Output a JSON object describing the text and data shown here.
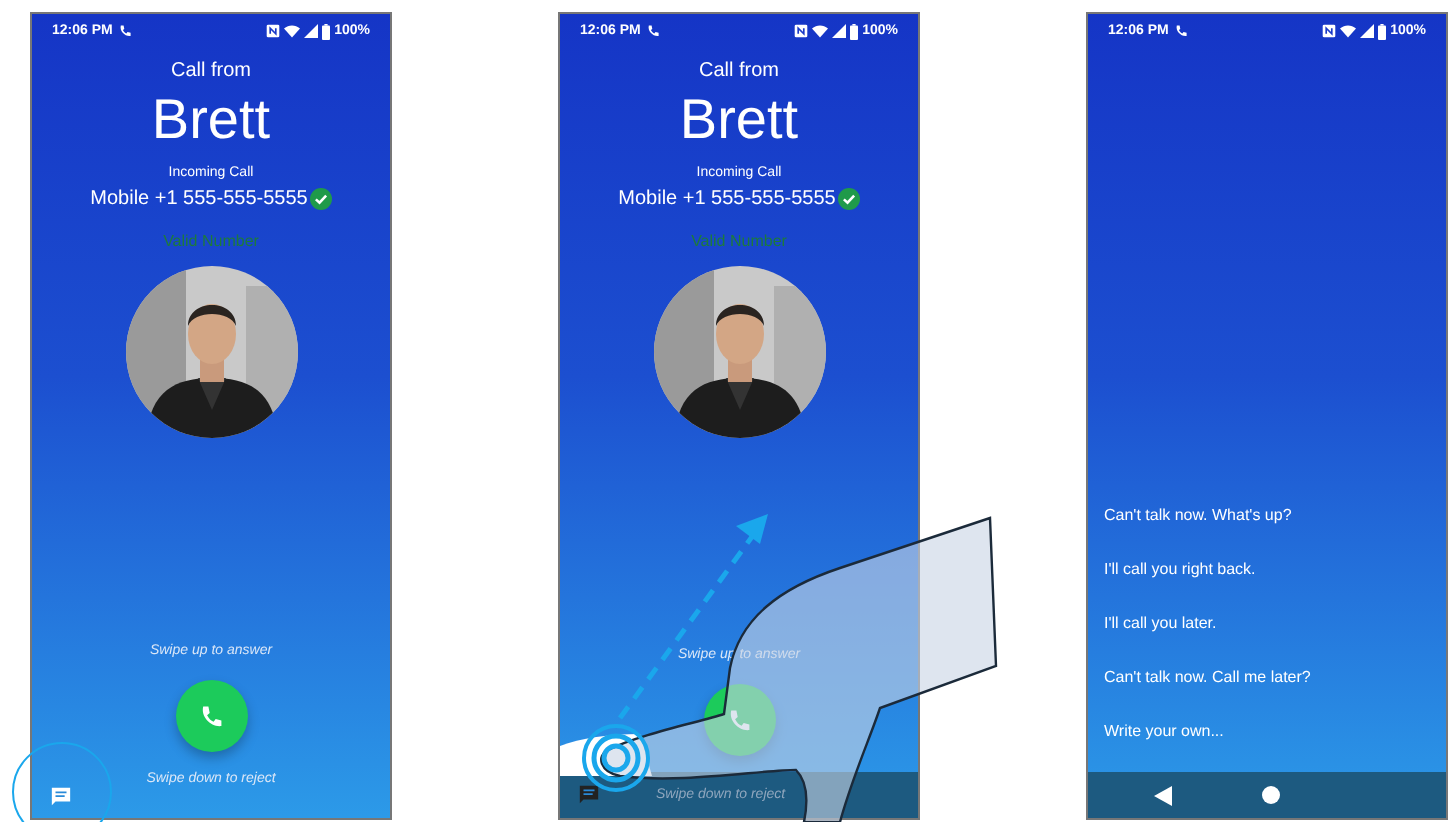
{
  "phones": [
    {
      "kind": "incoming",
      "status_bar": {
        "time": "12:06 PM",
        "battery": "100%"
      },
      "caller": {
        "heading": "Call from",
        "name": "Brett",
        "call_type": "Incoming Call",
        "number": "Mobile +1 555-555-5555",
        "verified": true,
        "verification": "Valid Number"
      },
      "answer_hint": "Swipe up to answer",
      "reject_hint": "Swipe down to reject",
      "message_highlighted": true,
      "gesture": false
    },
    {
      "kind": "incoming",
      "status_bar": {
        "time": "12:06 PM",
        "battery": "100%"
      },
      "caller": {
        "heading": "Call from",
        "name": "Brett",
        "call_type": "Incoming Call",
        "number": "Mobile +1 555-555-5555",
        "verified": true,
        "verification": "Valid Number"
      },
      "answer_hint": "Swipe up to answer",
      "reject_hint": "Swipe down to reject",
      "message_highlighted": false,
      "gesture": true
    },
    {
      "kind": "replies",
      "status_bar": {
        "time": "12:06 PM",
        "battery": "100%"
      },
      "replies": [
        "Can't talk now. What's up?",
        "I'll call you right back.",
        "I'll call you later.",
        "Can't talk now. Call me later?",
        "Write your own..."
      ]
    }
  ]
}
